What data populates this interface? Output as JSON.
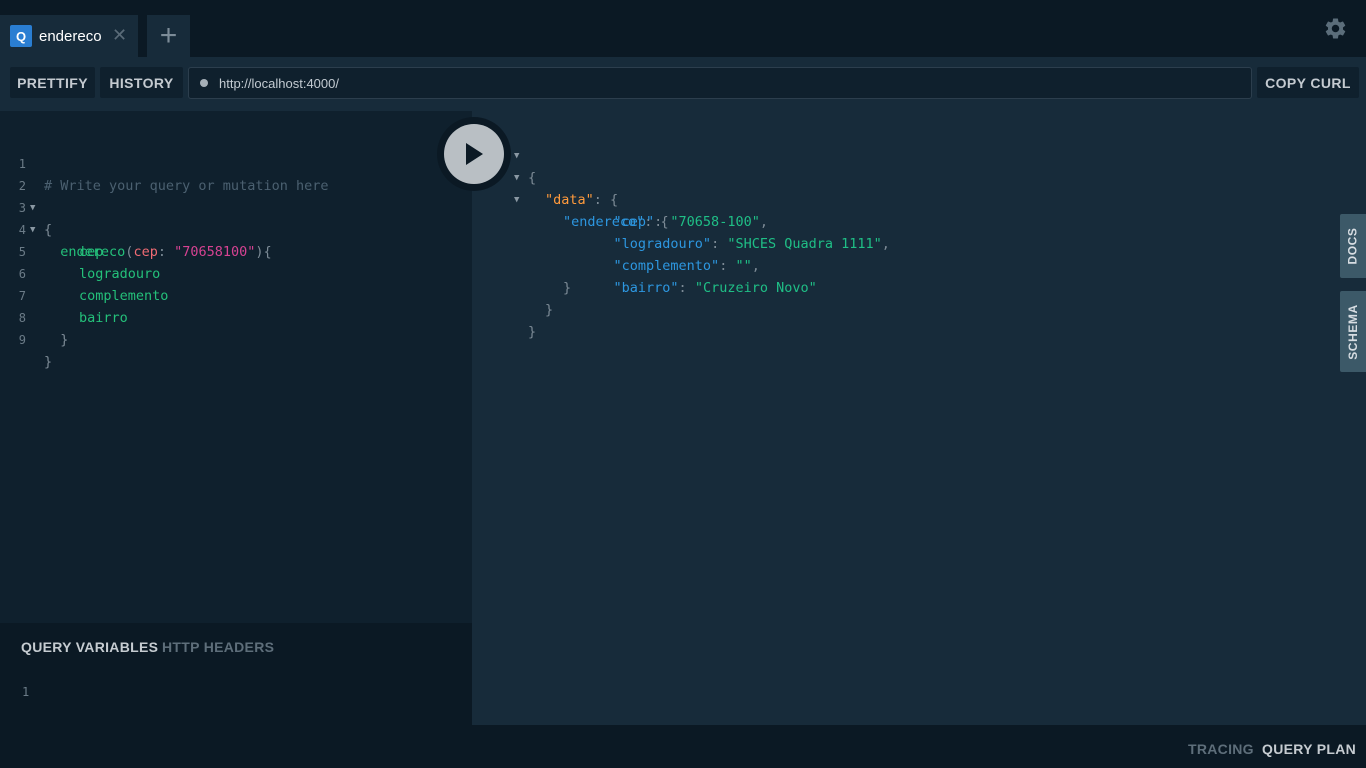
{
  "tabs": [
    {
      "badge": "Q",
      "label": "endereco",
      "close": "✕"
    }
  ],
  "add_tab_label": "+",
  "toolbar": {
    "prettify_label": "PRETTIFY",
    "history_label": "HISTORY",
    "url": "http://localhost:4000/",
    "copy_curl_label": "COPY CURL"
  },
  "editor": {
    "line_numbers": [
      "1",
      "2",
      "3",
      "4",
      "5",
      "6",
      "7",
      "8",
      "9"
    ],
    "lines": [
      "# Write your query or mutation here",
      "{",
      "  endereco(cep: \"70658100\"){",
      "    cep",
      "    logradouro",
      "    complemento",
      "    bairro",
      "  }",
      "}"
    ],
    "query_field": "endereco",
    "arg_name": "cep",
    "arg_value": "\"70658100\"",
    "fields": [
      "cep",
      "logradouro",
      "complemento",
      "bairro"
    ]
  },
  "variables_panel": {
    "tab_query_variables": "QUERY VARIABLES",
    "tab_http_headers": "HTTP HEADERS",
    "line_number": "1"
  },
  "result": {
    "data_key": "\"data\"",
    "endereco_key": "\"endereco\"",
    "entries": [
      {
        "key": "\"cep\"",
        "value": "\"70658-100\""
      },
      {
        "key": "\"logradouro\"",
        "value": "\"SHCES Quadra 1111\""
      },
      {
        "key": "\"complemento\"",
        "value": "\"\""
      },
      {
        "key": "\"bairro\"",
        "value": "\"Cruzeiro Novo\""
      }
    ]
  },
  "side_tabs": {
    "docs": "DOCS",
    "schema": "SCHEMA"
  },
  "footer": {
    "tracing": "TRACING",
    "query_plan": "QUERY PLAN"
  },
  "colors": {
    "background": "#0b1924",
    "panel": "#172b3a",
    "editor": "#0f202d",
    "accent": "#2a7ed2",
    "field": "#24c07a",
    "string": "#d64292",
    "json_key": "#2d97e0",
    "json_top_key": "#ff9a3c"
  }
}
